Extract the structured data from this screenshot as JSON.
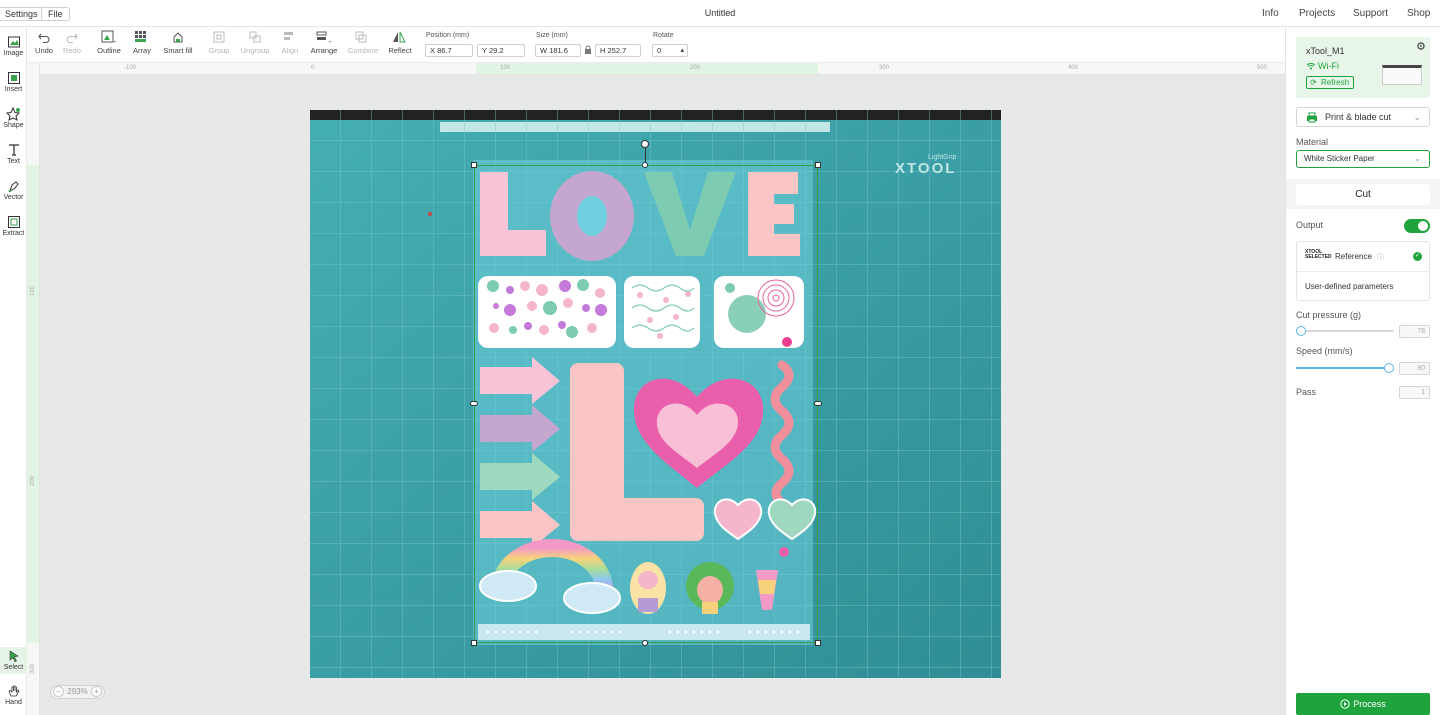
{
  "menubar": {
    "settings": "Settings",
    "file": "File",
    "title": "Untitled",
    "info": "Info",
    "projects": "Projects",
    "support": "Support",
    "shop": "Shop"
  },
  "toolbar": {
    "undo": "Undo",
    "redo": "Redo",
    "outline": "Outline",
    "array": "Array",
    "smart_fill": "Smart fill",
    "group": "Group",
    "ungroup": "Ungroup",
    "align": "Align",
    "arrange": "Arrange",
    "combine": "Combine",
    "reflect": "Reflect",
    "position_label": "Position (mm)",
    "x": "X 86.7",
    "y": "Y 29.2",
    "size_label": "Size (mm)",
    "w": "W 181.6",
    "h": "H 252.7",
    "rotate_label": "Rotate",
    "rotate": "0"
  },
  "left_tools": {
    "image": "Image",
    "insert": "Insert",
    "shape": "Shape",
    "text": "Text",
    "vector": "Vector",
    "extract": "Extract",
    "select": "Select",
    "hand": "Hand"
  },
  "ruler": {
    "top": [
      "-100",
      "0",
      "100",
      "200",
      "300",
      "400",
      "500"
    ],
    "left": [
      "100",
      "200",
      "300"
    ]
  },
  "canvas": {
    "zoom": "293%",
    "mat_brand": "XTOOL",
    "mat_sub": "LightGrip"
  },
  "panel": {
    "machine_name": "xTool_M1",
    "wifi": "Wi-Fi",
    "refresh": "Refresh",
    "mode": "Print & blade cut",
    "material_label": "Material",
    "material": "White Sticker Paper",
    "cut_tab": "Cut",
    "output": "Output",
    "output_on": true,
    "ref_brand_top": "XTOOL",
    "ref_brand_bottom": "SELECTED",
    "reference": "Reference",
    "user_defined": "User-defined parameters",
    "cut_pressure_label": "Cut pressure (g)",
    "cut_pressure": "78",
    "cut_pressure_level": 0.05,
    "speed_label": "Speed (mm/s)",
    "speed": "80",
    "speed_level": 0.95,
    "pass_label": "Pass",
    "pass": "1",
    "process": "Process"
  },
  "colors": {
    "accent": "#1fa33d",
    "mat": "#3aa0a6",
    "love_pink": "#f9c3d8",
    "love_purple": "#c5a6cf",
    "love_mint": "#7dcbb0",
    "heart": "#ea5fab"
  }
}
